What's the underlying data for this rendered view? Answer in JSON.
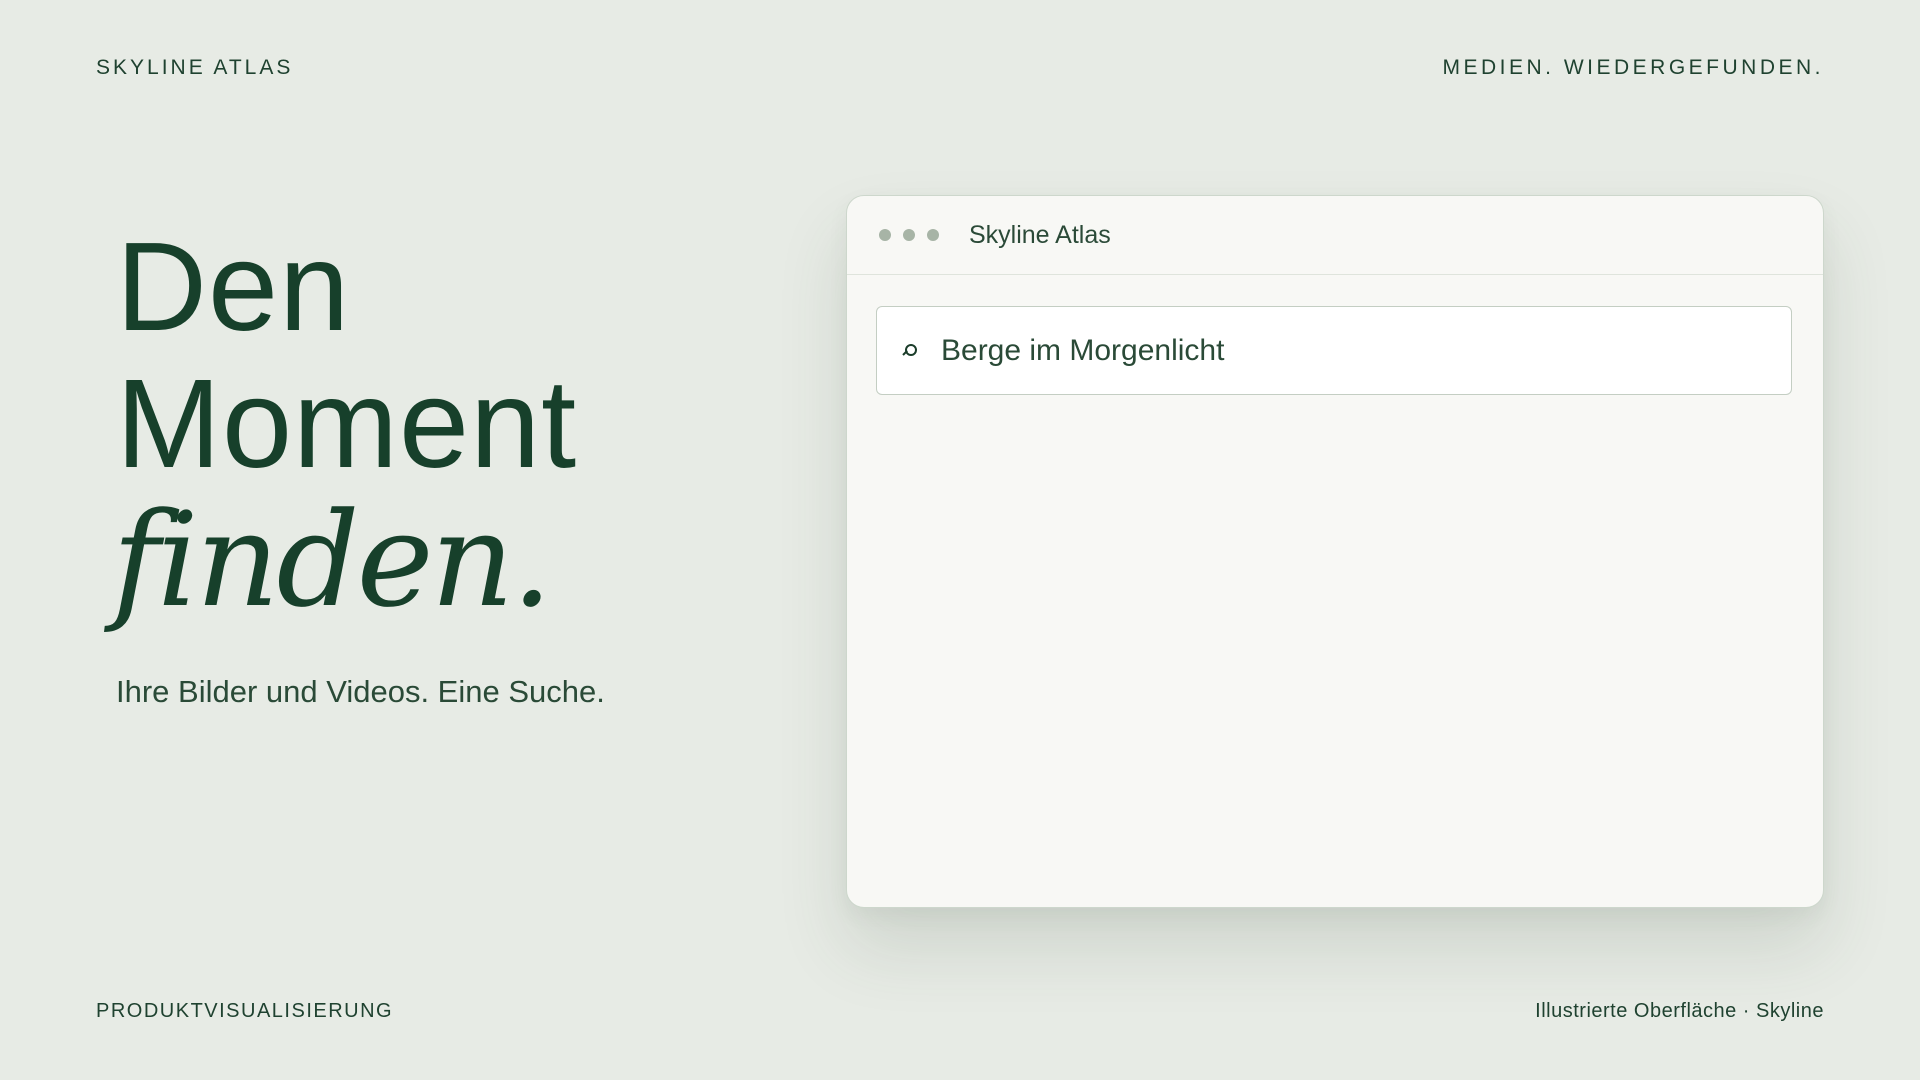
{
  "header": {
    "brand": "SKYLINE ATLAS",
    "tagline": "MEDIEN. WIEDERGEFUNDEN."
  },
  "hero": {
    "headline_lines": [
      "Den",
      "Moment",
      "finden."
    ],
    "subline": "Ihre Bilder und Videos. Eine Suche."
  },
  "window": {
    "title": "Skyline Atlas",
    "controls": [
      "window-dot",
      "window-dot",
      "window-dot"
    ],
    "search": {
      "icon": "search-icon",
      "value": "Berge im Morgenlicht"
    }
  },
  "footer": {
    "left": "PRODUKTVISUALISIERUNG",
    "right": "Illustrierte Oberfläche · Skyline"
  },
  "colors": {
    "background": "#e7ebe5",
    "text_dark_green": "#17402b",
    "window_bg": "#f8f8f5",
    "dot_gray": "#a7b4a6"
  }
}
